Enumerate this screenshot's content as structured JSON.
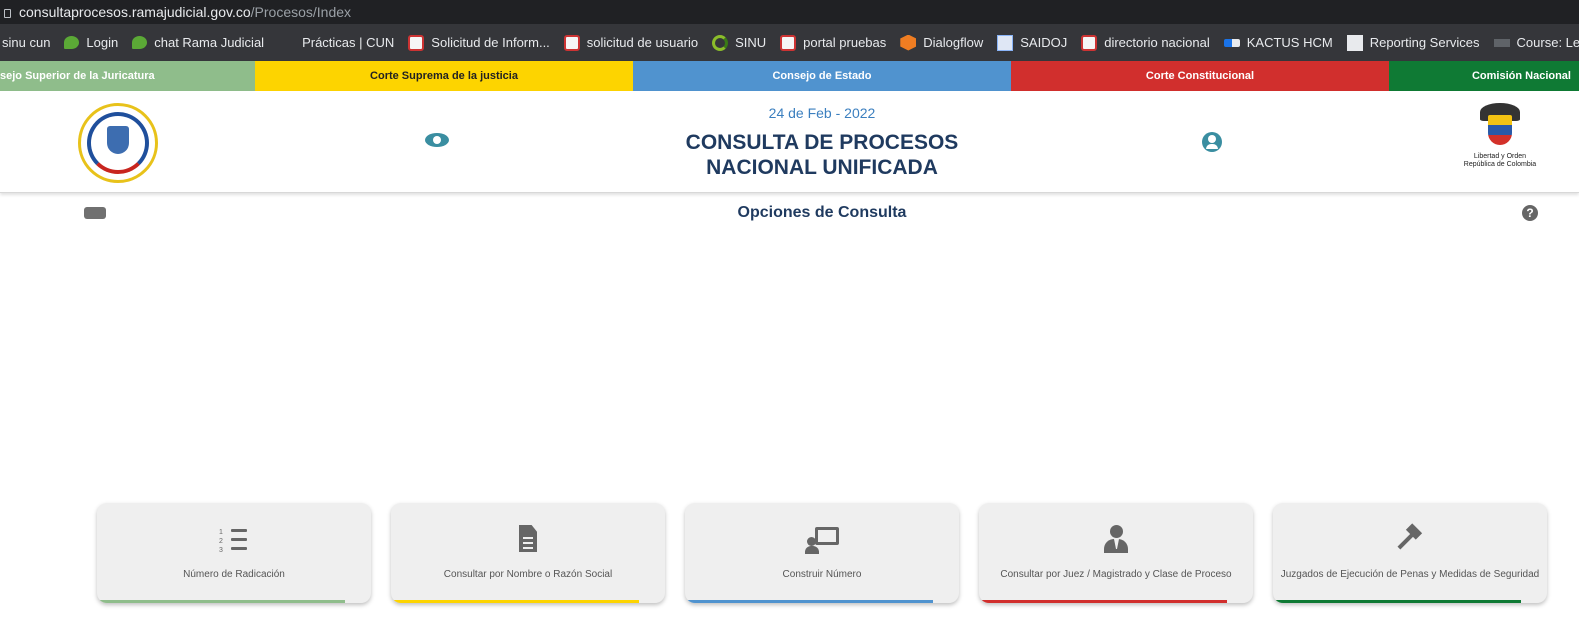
{
  "browser": {
    "url_host": "consultaprocesos.ramajudicial.gov.co",
    "url_path": "/Procesos/Index",
    "bookmarks": [
      {
        "label": "sinu cun",
        "icon": "none"
      },
      {
        "label": "Login",
        "icon": "chat-icon"
      },
      {
        "label": "chat Rama Judicial",
        "icon": "chat-icon"
      },
      {
        "label": "Prácticas | CUN",
        "icon": "none"
      },
      {
        "label": "Solicitud de Inform...",
        "icon": "seal-icon"
      },
      {
        "label": "solicitud de usuario",
        "icon": "seal-icon"
      },
      {
        "label": "SINU",
        "icon": "sinu-icon"
      },
      {
        "label": "portal pruebas",
        "icon": "seal-icon"
      },
      {
        "label": "Dialogflow",
        "icon": "dialogflow-icon"
      },
      {
        "label": "SAIDOJ",
        "icon": "doc-icon"
      },
      {
        "label": "directorio nacional",
        "icon": "seal-icon"
      },
      {
        "label": "KACTUS HCM",
        "icon": "kactus-icon"
      },
      {
        "label": "Reporting Services",
        "icon": "report-icon"
      },
      {
        "label": "Course: Learnathon...",
        "icon": "course-icon"
      }
    ]
  },
  "strip": {
    "items": [
      {
        "label": "sejo Superior de la Juricatura",
        "color": "#8fbd8b"
      },
      {
        "label": "Corte Suprema de la justicia",
        "color": "#fdd400"
      },
      {
        "label": "Consejo de Estado",
        "color": "#5093cf"
      },
      {
        "label": "Corte Constitucional",
        "color": "#d12f2d"
      },
      {
        "label": "Comisión Nacional",
        "color": "#0f7a34"
      }
    ]
  },
  "header": {
    "date": "24 de Feb - 2022",
    "title_line1": "CONSULTA DE PROCESOS",
    "title_line2": "NACIONAL UNIFICADA",
    "logo_right_line1": "Libertad y Orden",
    "logo_right_line2": "República de Colombia"
  },
  "options": {
    "title": "Opciones de Consulta",
    "help": "?"
  },
  "cards": [
    {
      "label": "Número de Radicación",
      "icon": "numbered-list-icon",
      "color": "#8fbd8b"
    },
    {
      "label": "Consultar por Nombre o Razón Social",
      "icon": "document-icon",
      "color": "#fdd400"
    },
    {
      "label": "Construir Número",
      "icon": "presentation-icon",
      "color": "#5093cf"
    },
    {
      "label": "Consultar por Juez / Magistrado y Clase de Proceso",
      "icon": "judge-icon",
      "color": "#d12f2d"
    },
    {
      "label": "Juzgados de Ejecución de Penas y Medidas de Seguridad",
      "icon": "gavel-icon",
      "color": "#0f7a34"
    }
  ]
}
